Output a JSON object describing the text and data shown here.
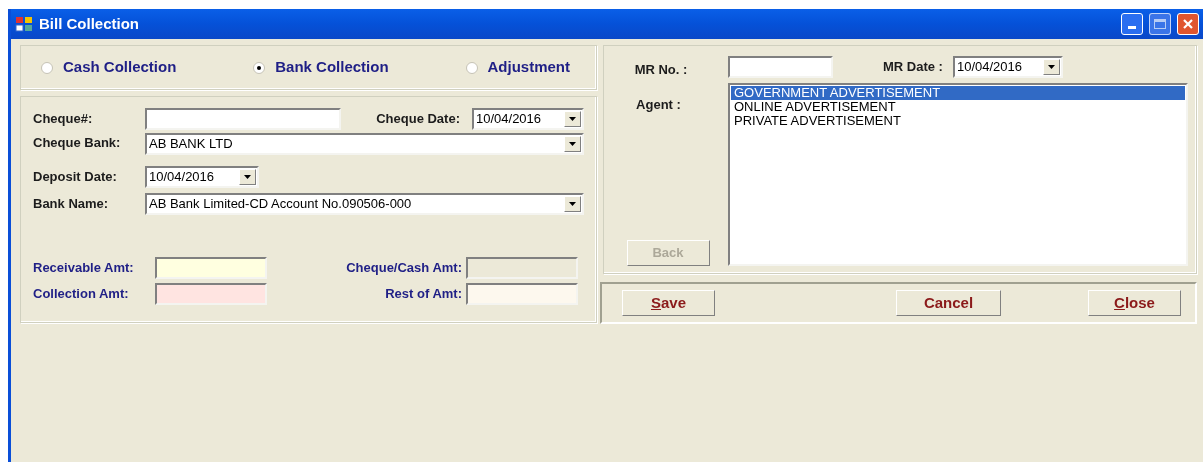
{
  "window": {
    "title": "Bill Collection"
  },
  "collection_types": [
    {
      "label": "Cash Collection",
      "selected": false
    },
    {
      "label": "Bank Collection",
      "selected": true
    },
    {
      "label": "Adjustment",
      "selected": false
    }
  ],
  "cheque": {
    "number_label": "Cheque#:",
    "date_label": "Cheque Date:",
    "date_value": "10/04/2016",
    "bank_label": "Cheque Bank:",
    "bank_value": "AB BANK LTD"
  },
  "deposit": {
    "date_label": "Deposit Date:",
    "date_value": "10/04/2016",
    "bank_label": "Bank Name:",
    "bank_value": "AB Bank Limited-CD Account No.090506-000"
  },
  "amounts": [
    {
      "label": "Receivable Amt:",
      "color": "#ffffe0"
    },
    {
      "label": "Cheque/Cash Amt:",
      "color": "#ece9d8"
    },
    {
      "label": "Collection Amt:",
      "color": "#ffe4e1"
    },
    {
      "label": "Rest of Amt:",
      "color": "#fdf8ee"
    }
  ],
  "mr": {
    "number_label": "MR No. :",
    "date_label": "MR Date :",
    "date_value": "10/04/2016"
  },
  "agent": {
    "label": "Agent :",
    "items": [
      {
        "label": "GOVERNMENT ADVERTISEMENT",
        "selected": true
      },
      {
        "label": "ONLINE ADVERTISEMENT",
        "selected": false
      },
      {
        "label": "PRIVATE ADVERTISEMENT",
        "selected": false
      }
    ]
  },
  "back_button": {
    "label": "Back",
    "disabled": true
  },
  "actions": [
    {
      "label": "Save",
      "underline_first": true
    },
    {
      "label": "Cancel",
      "underline_first": false
    },
    {
      "label": "Close",
      "underline_first": true
    }
  ]
}
